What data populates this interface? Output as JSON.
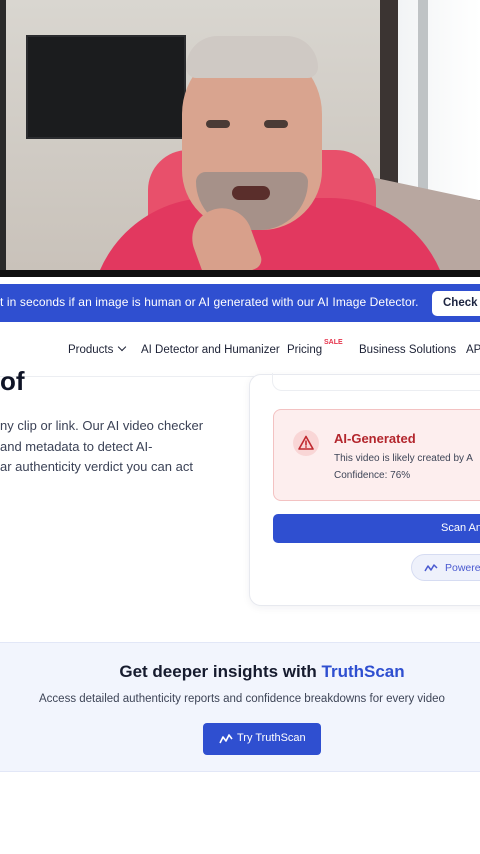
{
  "banner": {
    "text": "t in seconds if an image is human or AI generated with our AI Image Detector.",
    "cta_label": "Check N"
  },
  "nav": {
    "items": [
      {
        "label": "Products"
      },
      {
        "label": "AI Detector and Humanizer"
      },
      {
        "label": "Pricing"
      },
      {
        "label": "Business Solutions"
      },
      {
        "label": "AP"
      }
    ],
    "pricing_badge": "SALE"
  },
  "hero": {
    "title_tail": "of",
    "description_lines": [
      "ny clip or link. Our AI video checker",
      "and metadata to detect AI-",
      "ar authenticity verdict you can act"
    ]
  },
  "result": {
    "title": "AI-Generated",
    "subtitle": "This video is likely created by A",
    "confidence": "Confidence: 76%",
    "scan_button": "Scan An",
    "powered_label": "Powere"
  },
  "insights": {
    "title_prefix": "Get deeper insights with",
    "title_brand": "TruthScan",
    "description": "Access detailed authenticity reports and confidence breakdowns for every video",
    "button_label": "Try TruthScan"
  },
  "colors": {
    "primary": "#2f4fd0",
    "danger": "#b3262d",
    "danger_bg": "#fdeeee"
  }
}
